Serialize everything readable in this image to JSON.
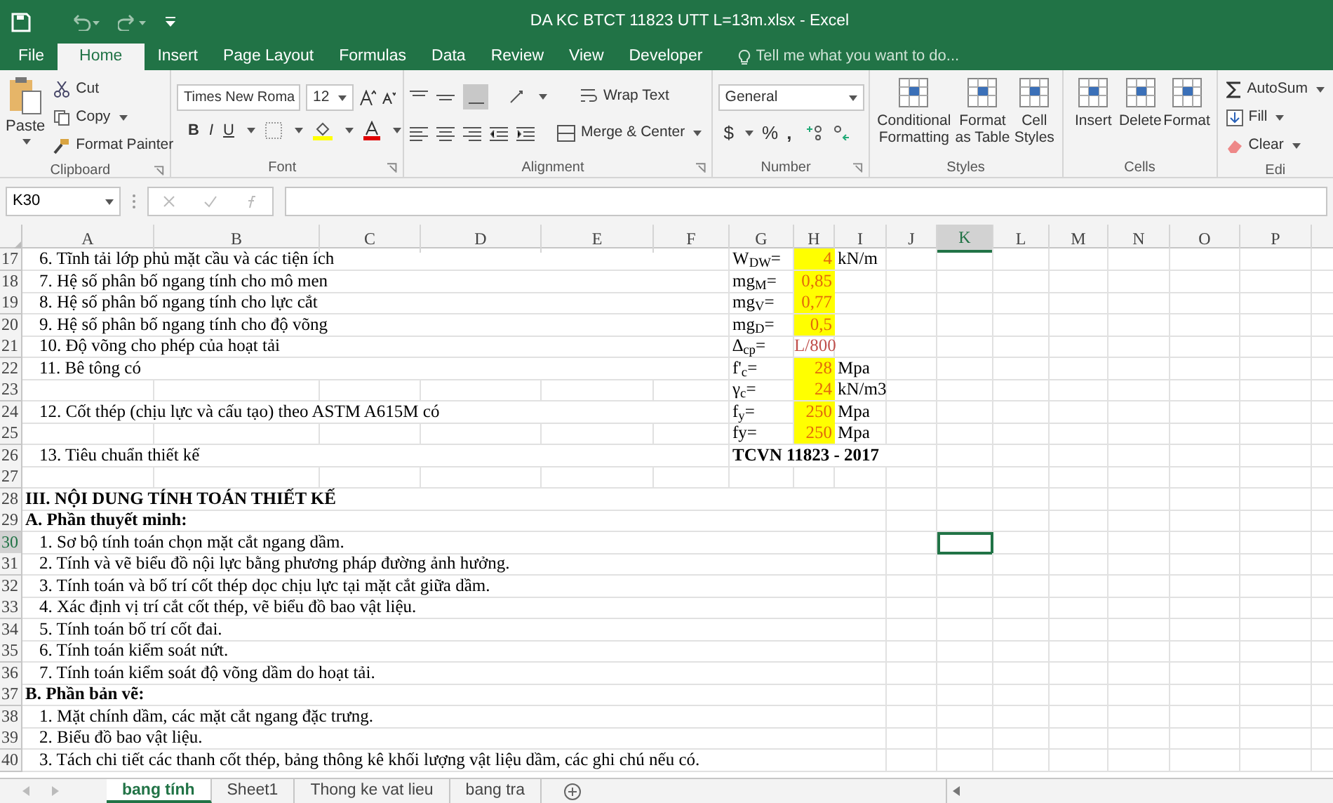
{
  "window": {
    "title": "DA KC BTCT 11823 UTT L=13m.xlsx - Excel"
  },
  "tabs": [
    {
      "label": "File",
      "selected": false
    },
    {
      "label": "Home",
      "selected": true
    },
    {
      "label": "Insert",
      "selected": false
    },
    {
      "label": "Page Layout",
      "selected": false
    },
    {
      "label": "Formulas",
      "selected": false
    },
    {
      "label": "Data",
      "selected": false
    },
    {
      "label": "Review",
      "selected": false
    },
    {
      "label": "View",
      "selected": false
    },
    {
      "label": "Developer",
      "selected": false
    }
  ],
  "tell_me": {
    "placeholder": "Tell me what you want to do..."
  },
  "ribbon": {
    "clipboard": {
      "label": "Clipboard",
      "paste": "Paste",
      "cut": "Cut",
      "copy": "Copy",
      "format_painter": "Format Painter"
    },
    "font": {
      "label": "Font",
      "name": "Times New Roma",
      "size": "12",
      "bold": "B",
      "italic": "I",
      "underline": "U"
    },
    "alignment": {
      "label": "Alignment",
      "wrap_text": "Wrap Text",
      "merge_center": "Merge & Center"
    },
    "number": {
      "label": "Number",
      "format": "General",
      "currency": "$",
      "percent": "%",
      "comma": ","
    },
    "styles": {
      "label": "Styles",
      "buttons": [
        "Conditional Formatting",
        "Format as Table",
        "Cell Styles"
      ]
    },
    "cells": {
      "label": "Cells",
      "buttons": [
        "Insert",
        "Delete",
        "Format"
      ]
    },
    "editing": {
      "label": "Edi",
      "buttons": [
        "AutoSum",
        "Fill",
        "Clear"
      ]
    }
  },
  "name_box": "K30",
  "columns": [
    {
      "label": "A",
      "selected": false
    },
    {
      "label": "B",
      "selected": false
    },
    {
      "label": "C",
      "selected": false
    },
    {
      "label": "D",
      "selected": false
    },
    {
      "label": "E",
      "selected": false
    },
    {
      "label": "F",
      "selected": false
    },
    {
      "label": "G",
      "selected": false
    },
    {
      "label": "H",
      "selected": false
    },
    {
      "label": "I",
      "selected": false
    },
    {
      "label": "J",
      "selected": false
    },
    {
      "label": "K",
      "selected": true
    },
    {
      "label": "L",
      "selected": false
    },
    {
      "label": "M",
      "selected": false
    },
    {
      "label": "N",
      "selected": false
    },
    {
      "label": "O",
      "selected": false
    },
    {
      "label": "P",
      "selected": false
    }
  ],
  "rows": [
    {
      "number": "17",
      "selected": false,
      "kind": "item",
      "text": "6. Tĩnh tải lớp phủ mặt cầu và các tiện ích",
      "g": {
        "text": "W$_{DW}$=",
        "bold": false
      },
      "h": {
        "text": "4",
        "highlighted": true
      },
      "i": "kN/m"
    },
    {
      "number": "18",
      "selected": false,
      "kind": "item",
      "text": "7. Hệ số phân bố ngang tính cho mô men",
      "g": {
        "text": "mg$_{M}$=",
        "bold": false
      },
      "h": {
        "text": "0,85",
        "highlighted": true
      }
    },
    {
      "number": "19",
      "selected": false,
      "kind": "item",
      "text": "8. Hệ số phân bố ngang tính cho lực cắt",
      "g": {
        "text": "mg$_{V}$=",
        "bold": false
      },
      "h": {
        "text": "0,77",
        "highlighted": true
      }
    },
    {
      "number": "20",
      "selected": false,
      "kind": "item",
      "text": "9. Hệ số phân bố ngang tính cho độ võng",
      "g": {
        "text": "mg$_{D}$=",
        "bold": false
      },
      "h": {
        "text": "0,5",
        "highlighted": true
      }
    },
    {
      "number": "21",
      "selected": false,
      "kind": "item",
      "text": "10. Độ võng cho phép của hoạt tải",
      "g": {
        "text": "∆$_{cp}$=",
        "bold": false
      },
      "h": {
        "text": "L/800",
        "highlighted": false
      }
    },
    {
      "number": "22",
      "selected": false,
      "kind": "item",
      "text": "11. Bê tông có",
      "g": {
        "text": "f'$_{c}$=",
        "bold": false
      },
      "h": {
        "text": "28",
        "highlighted": true
      },
      "i": "Mpa"
    },
    {
      "number": "23",
      "selected": false,
      "kind": "blank",
      "g": {
        "text": "γ$_{c}$=",
        "bold": false
      },
      "h": {
        "text": "24",
        "highlighted": true
      },
      "i": "kN/m3"
    },
    {
      "number": "24",
      "selected": false,
      "kind": "item",
      "text": "12. Cốt thép (chịu lực và cấu tạo) theo ASTM A615M có",
      "g": {
        "text": "f$_{y}$=",
        "bold": false
      },
      "h": {
        "text": "250",
        "highlighted": true
      },
      "i": "Mpa"
    },
    {
      "number": "25",
      "selected": false,
      "kind": "blank",
      "g": {
        "text": "fy=",
        "bold": false
      },
      "h": {
        "text": "250",
        "highlighted": true
      },
      "i": "Mpa"
    },
    {
      "number": "26",
      "selected": false,
      "kind": "item",
      "text": "13. Tiêu chuẩn thiết kế",
      "g": {
        "text": "TCVN 11823 - 2017",
        "bold": true
      }
    },
    {
      "number": "27",
      "selected": false,
      "kind": "blank"
    },
    {
      "number": "28",
      "selected": false,
      "kind": "heading",
      "text": "III. NỘI DUNG TÍNH TOÁN THIẾT KẾ"
    },
    {
      "number": "29",
      "selected": false,
      "kind": "heading",
      "text": "A. Phần thuyết minh:"
    },
    {
      "number": "30",
      "selected": true,
      "kind": "item",
      "text": "1. Sơ bộ tính toán chọn mặt cắt ngang dầm."
    },
    {
      "number": "31",
      "selected": false,
      "kind": "item",
      "text": "2. Tính và vẽ biểu đồ nội lực bằng phương pháp đường ảnh hưởng."
    },
    {
      "number": "32",
      "selected": false,
      "kind": "item",
      "text": "3. Tính toán và bố trí cốt thép dọc chịu lực tại mặt cắt giữa dầm."
    },
    {
      "number": "33",
      "selected": false,
      "kind": "item",
      "text": "4. Xác định vị trí cắt cốt thép, vẽ biểu đồ bao vật liệu."
    },
    {
      "number": "34",
      "selected": false,
      "kind": "item",
      "text": "5. Tính toán bố trí cốt đai."
    },
    {
      "number": "35",
      "selected": false,
      "kind": "item",
      "text": "6. Tính toán kiểm soát nứt."
    },
    {
      "number": "36",
      "selected": false,
      "kind": "item",
      "text": "7. Tính toán kiểm soát độ võng dầm do hoạt tải."
    },
    {
      "number": "37",
      "selected": false,
      "kind": "heading",
      "text": "B. Phần bản vẽ:"
    },
    {
      "number": "38",
      "selected": false,
      "kind": "item",
      "text": "1. Mặt chính dầm, các mặt cắt ngang đặc trưng."
    },
    {
      "number": "39",
      "selected": false,
      "kind": "item",
      "text": "2. Biểu đồ bao vật liệu."
    },
    {
      "number": "40",
      "selected": false,
      "kind": "item",
      "text": "3. Tách chi tiết các thanh cốt thép, bảng thông kê khối lượng vật liệu dầm, các ghi chú nếu có."
    }
  ],
  "sheet_tabs": [
    {
      "label": "bang tính",
      "selected": true
    },
    {
      "label": "Sheet1",
      "selected": false
    },
    {
      "label": "Thong ke vat lieu",
      "selected": false
    },
    {
      "label": "bang tra",
      "selected": false
    }
  ]
}
